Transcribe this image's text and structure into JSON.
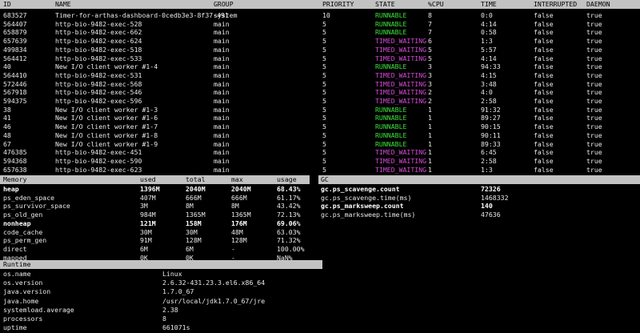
{
  "threads": {
    "headers": [
      "ID",
      "NAME",
      "GROUP",
      "PRIORITY",
      "STATE",
      "%CPU",
      "TIME",
      "INTERRUPTED",
      "DAEMON"
    ],
    "rows": [
      [
        "683527",
        "Timer-for-arthas-dashboard-0cedb3e3-8f37-491",
        "system",
        "10",
        "RUNNABLE",
        "8",
        "0:0",
        "false",
        "true"
      ],
      [
        "564407",
        "http-bio-9482-exec-528",
        "main",
        "5",
        "RUNNABLE",
        "7",
        "4:14",
        "false",
        "true"
      ],
      [
        "658879",
        "http-bio-9482-exec-662",
        "main",
        "5",
        "RUNNABLE",
        "7",
        "0:58",
        "false",
        "true"
      ],
      [
        "657639",
        "http-bio-9482-exec-624",
        "main",
        "5",
        "TIMED_WAITING",
        "6",
        "1:3",
        "false",
        "true"
      ],
      [
        "499834",
        "http-bio-9482-exec-518",
        "main",
        "5",
        "TIMED_WAITING",
        "5",
        "5:57",
        "false",
        "true"
      ],
      [
        "564412",
        "http-bio-9482-exec-533",
        "main",
        "5",
        "TIMED_WAITING",
        "5",
        "4:14",
        "false",
        "true"
      ],
      [
        "40",
        "New I/O client worker #1-4",
        "main",
        "5",
        "RUNNABLE",
        "3",
        "94:33",
        "false",
        "true"
      ],
      [
        "564410",
        "http-bio-9482-exec-531",
        "main",
        "5",
        "TIMED_WAITING",
        "3",
        "4:15",
        "false",
        "true"
      ],
      [
        "572446",
        "http-bio-9482-exec-568",
        "main",
        "5",
        "TIMED_WAITING",
        "3",
        "3:48",
        "false",
        "true"
      ],
      [
        "567918",
        "http-bio-9482-exec-546",
        "main",
        "5",
        "TIMED_WAITING",
        "2",
        "4:0",
        "false",
        "true"
      ],
      [
        "594375",
        "http-bio-9482-exec-596",
        "main",
        "5",
        "TIMED_WAITING",
        "2",
        "2:58",
        "false",
        "true"
      ],
      [
        "38",
        "New I/O client worker #1-3",
        "main",
        "5",
        "RUNNABLE",
        "1",
        "91:32",
        "false",
        "true"
      ],
      [
        "41",
        "New I/O client worker #1-6",
        "main",
        "5",
        "RUNNABLE",
        "1",
        "89:27",
        "false",
        "true"
      ],
      [
        "46",
        "New I/O client worker #1-7",
        "main",
        "5",
        "RUNNABLE",
        "1",
        "90:15",
        "false",
        "true"
      ],
      [
        "48",
        "New I/O client worker #1-8",
        "main",
        "5",
        "RUNNABLE",
        "1",
        "90:11",
        "false",
        "true"
      ],
      [
        "67",
        "New I/O client worker #1-9",
        "main",
        "5",
        "RUNNABLE",
        "1",
        "89:33",
        "false",
        "true"
      ],
      [
        "476385",
        "http-bio-9482-exec-451",
        "main",
        "5",
        "TIMED_WAITING",
        "1",
        "6:45",
        "false",
        "true"
      ],
      [
        "594368",
        "http-bio-9482-exec-590",
        "main",
        "5",
        "TIMED_WAITING",
        "1",
        "2:58",
        "false",
        "true"
      ],
      [
        "657638",
        "http-bio-9482-exec-623",
        "main",
        "5",
        "TIMED_WAITING",
        "1",
        "1:3",
        "false",
        "true"
      ]
    ]
  },
  "memory": {
    "headers": [
      "Memory",
      "used",
      "total",
      "max",
      "usage"
    ],
    "rows": [
      [
        "heap",
        "1396M",
        "2040M",
        "2040M",
        "68.43%"
      ],
      [
        "ps_eden_space",
        "407M",
        "666M",
        "666M",
        "61.17%"
      ],
      [
        "ps_survivor_space",
        "3M",
        "8M",
        "8M",
        "43.42%"
      ],
      [
        "ps_old_gen",
        "984M",
        "1365M",
        "1365M",
        "72.13%"
      ],
      [
        "nonheap",
        "121M",
        "158M",
        "176M",
        "69.06%"
      ],
      [
        "code_cache",
        "30M",
        "30M",
        "48M",
        "63.03%"
      ],
      [
        "ps_perm_gen",
        "91M",
        "128M",
        "128M",
        "71.32%"
      ],
      [
        "direct",
        "6M",
        "6M",
        "-",
        "100.00%"
      ],
      [
        "mapped",
        "0K",
        "0K",
        "-",
        "NaN%"
      ]
    ]
  },
  "gc": {
    "header": "GC",
    "rows": [
      [
        "gc.ps_scavenge.count",
        "72326"
      ],
      [
        "gc.ps_scavenge.time(ms)",
        "1468332"
      ],
      [
        "gc.ps_marksweep.count",
        "140"
      ],
      [
        "gc.ps_marksweep.time(ms)",
        "47636"
      ]
    ]
  },
  "runtime": {
    "header": "Runtime",
    "rows": [
      [
        "os.name",
        "Linux"
      ],
      [
        "os.version",
        "2.6.32-431.23.3.el6.x86_64"
      ],
      [
        "java.version",
        "1.7.0_67"
      ],
      [
        "java.home",
        "/usr/local/jdk1.7.0_67/jre"
      ],
      [
        "systemload.average",
        "2.38"
      ],
      [
        "processors",
        "8"
      ],
      [
        "uptime",
        "661071s"
      ]
    ]
  },
  "colors": {
    "runnable": "#3ee13e",
    "timed_waiting": "#d84ad8",
    "header_bar": "#c2c2c2"
  }
}
